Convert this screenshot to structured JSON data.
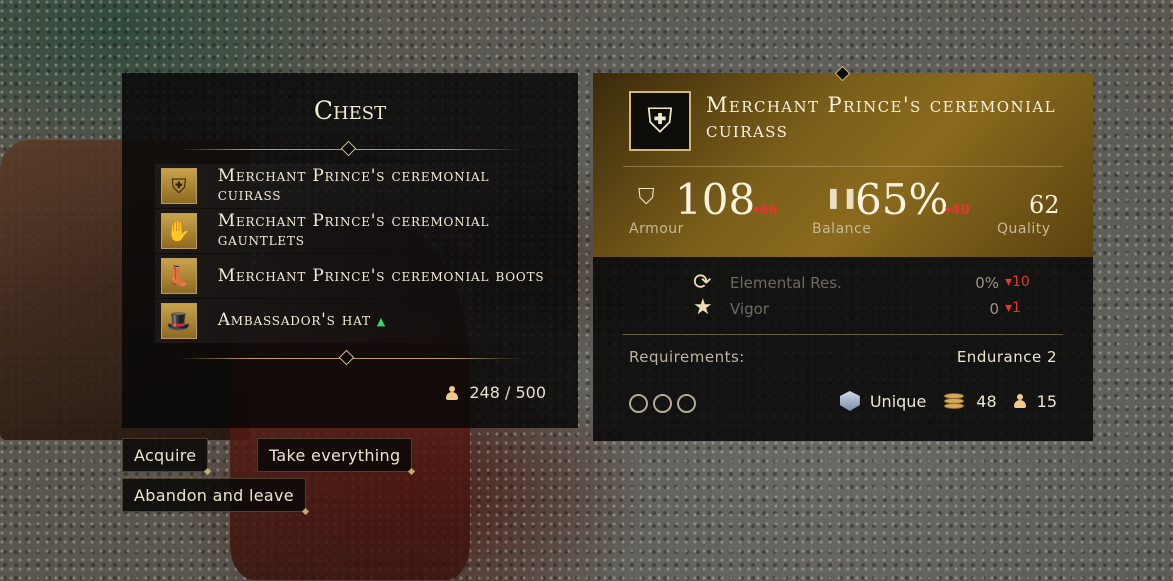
{
  "chest": {
    "title": "Chest",
    "items": [
      {
        "name": "Merchant Prince's ceremonial cuirass",
        "icon": "cuirass-icon",
        "glyph": "⛨",
        "improved": false
      },
      {
        "name": "Merchant Prince's ceremonial gauntlets",
        "icon": "gauntlets-icon",
        "glyph": "✋",
        "improved": false
      },
      {
        "name": "Merchant Prince's ceremonial boots",
        "icon": "boots-icon",
        "glyph": "👢",
        "improved": false
      },
      {
        "name": "Ambassador's hat",
        "icon": "hat-icon",
        "glyph": "🎩",
        "improved": true
      }
    ],
    "weight": "248 / 500"
  },
  "actions": {
    "acquire": "Acquire",
    "take_everything": "Take everything",
    "abandon": "Abandon and leave"
  },
  "detail": {
    "name": "Merchant Prince's ceremonial cuirass",
    "icon": "cuirass-icon",
    "armour": {
      "value": "108",
      "delta": "▾66",
      "label": "Armour"
    },
    "balance": {
      "value": "65%",
      "delta": "▾40",
      "label": "Balance"
    },
    "quality": {
      "value": "62",
      "label": "Quality"
    },
    "elemental_res": {
      "label": "Elemental Res.",
      "value": "0%",
      "delta": "▾10"
    },
    "vigor": {
      "label": "Vigor",
      "value": "0",
      "delta": "▾1"
    },
    "requirements_label": "Requirements:",
    "requirements_value": "Endurance 2",
    "rarity": "Unique",
    "price": "48",
    "weight": "15"
  },
  "colors": {
    "gold": "#b89a5c",
    "panel": "#080808",
    "negative": "#e03a2c",
    "positive": "#3bd46a"
  }
}
